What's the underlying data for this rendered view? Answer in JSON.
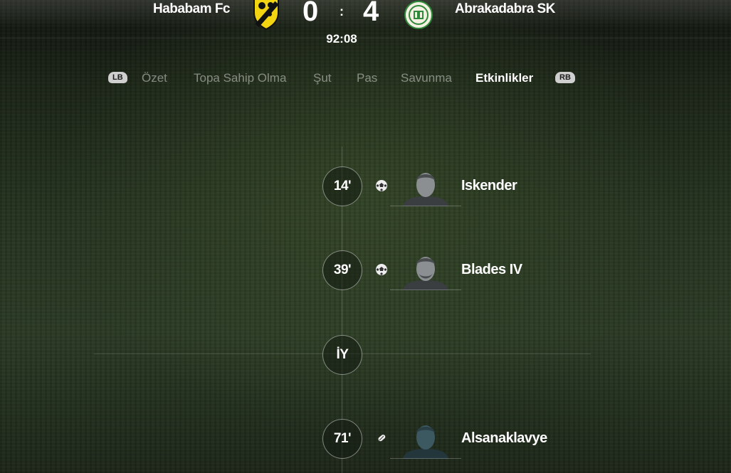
{
  "match": {
    "home_team": "Hababam Fc",
    "away_team": "Abrakadabra SK",
    "home_score": "0",
    "away_score": "4",
    "separator": ":",
    "clock": "92:08"
  },
  "tabs": {
    "left_bumper": "LB",
    "right_bumper": "RB",
    "items": [
      {
        "label": "Özet",
        "active": false
      },
      {
        "label": "Topa Sahip Olma",
        "active": false
      },
      {
        "label": "Şut",
        "active": false
      },
      {
        "label": "Pas",
        "active": false
      },
      {
        "label": "Savunma",
        "active": false
      },
      {
        "label": "Etkinlikler",
        "active": true
      }
    ]
  },
  "events": [
    {
      "minute": "14'",
      "icon": "goal-ball-icon",
      "player": "Iskender"
    },
    {
      "minute": "39'",
      "icon": "goal-ball-icon",
      "player": "Blades IV"
    },
    {
      "minute": "İY",
      "icon": "",
      "player": ""
    },
    {
      "minute": "71'",
      "icon": "substitution-icon",
      "player": "Alsanaklavye"
    }
  ],
  "colors": {
    "home_crest_primary": "#f2d410",
    "home_crest_secondary": "#111111",
    "away_crest_primary": "#2f8a3b",
    "away_crest_secondary": "#f4f1e2"
  }
}
